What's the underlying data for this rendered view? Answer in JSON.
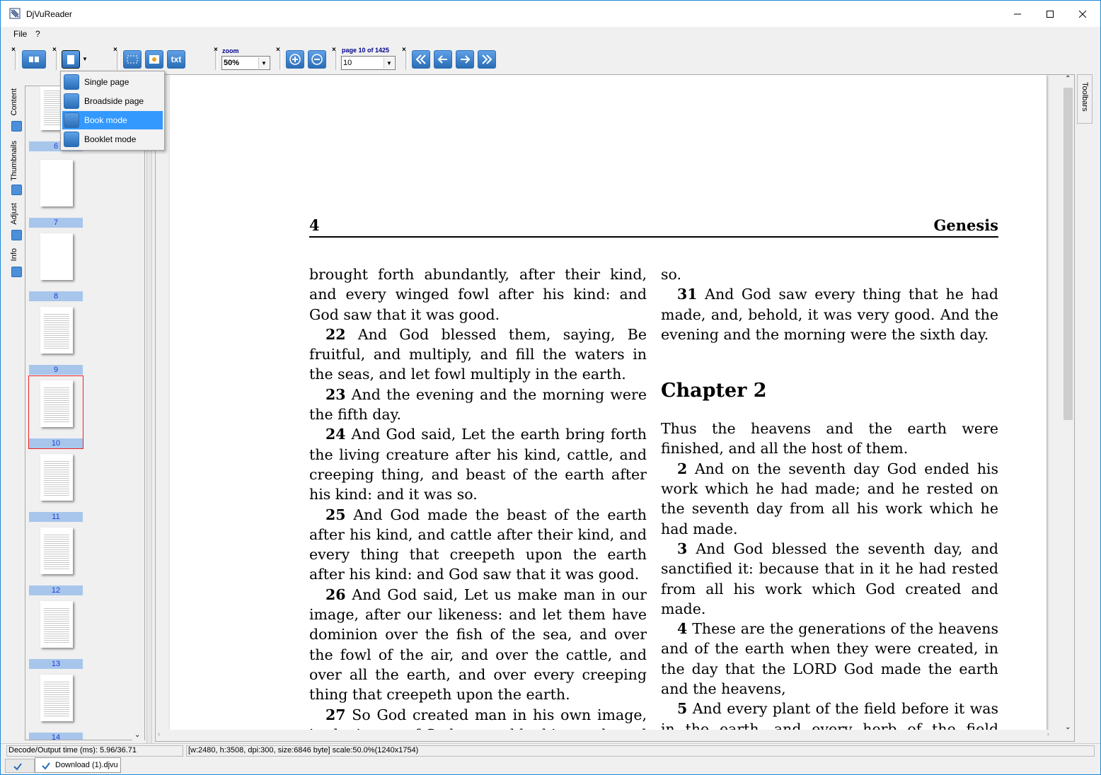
{
  "window": {
    "title": "DjVuReader"
  },
  "menubar": {
    "items": [
      "File",
      "?"
    ]
  },
  "toolbar": {
    "close_glyph": "×",
    "zoom_label": "zoom",
    "zoom_value": "50%",
    "page_label": "page 10 of 1425",
    "page_value": "10",
    "text_button_label": "txt"
  },
  "view_mode_menu": {
    "items": [
      {
        "label": "Single page",
        "icon": "single-page-icon"
      },
      {
        "label": "Broadside page",
        "icon": "broadside-page-icon"
      },
      {
        "label": "Book mode",
        "icon": "book-mode-icon",
        "selected": true
      },
      {
        "label": "Booklet mode",
        "icon": "booklet-mode-icon"
      }
    ]
  },
  "side_tabs": [
    "Content",
    "Thumbnails",
    "Adjust",
    "Info"
  ],
  "thumbnails": {
    "pages": [
      "6",
      "7",
      "8",
      "9",
      "10",
      "11",
      "12",
      "13",
      "14"
    ],
    "selected": "10"
  },
  "right_tab": "Toolbars",
  "document": {
    "page_number": "4",
    "running_title": "Genesis",
    "left_column": [
      {
        "num": "",
        "text": "brought forth abundantly, after their kind, and every winged fowl after his kind: and God saw that it was good."
      },
      {
        "num": "22",
        "text": "And God blessed them, saying, Be fruitful, and multiply, and fill the waters in the seas, and let fowl multiply in the earth."
      },
      {
        "num": "23",
        "text": "And the evening and the morning were the fifth day."
      },
      {
        "num": "24",
        "text": "And God said, Let the earth bring forth the living creature after his kind, cattle, and creeping thing, and beast of the earth after his kind: and it was so."
      },
      {
        "num": "25",
        "text": "And God made the beast of the earth after his kind, and cattle after their kind, and every thing that creepeth upon the earth after his kind: and God saw that it was good."
      },
      {
        "num": "26",
        "text": "And God said, Let us make man in our image, after our likeness: and let them have dominion over the fish of the sea, and over the fowl of the air, and over the cattle, and over all the earth, and over every creeping thing that creepeth upon the earth."
      },
      {
        "num": "27",
        "text": "So God created man in his own image, in the image of God created he him; male and female created he them."
      }
    ],
    "right_column_top": [
      {
        "num": "",
        "text": "so."
      },
      {
        "num": "31",
        "text": "And God saw every thing that he had made, and, behold, it was very good. And the evening and the morning were the sixth day."
      }
    ],
    "chapter_heading": "Chapter 2",
    "right_column_bottom": [
      {
        "num": "",
        "text": "Thus the heavens and the earth were finished, and all the host of them."
      },
      {
        "num": "2",
        "text": "And on the seventh day God ended his work which he had made; and he rested on the seventh day from all his work which he had made."
      },
      {
        "num": "3",
        "text": "And God blessed the seventh day, and sanctified it: because that in it he had rested from all his work which God created and made."
      },
      {
        "num": "4",
        "text": "These are the generations of the heavens and of the earth when they were created, in the day that the LORD God made the earth and the heavens,"
      },
      {
        "num": "5",
        "text": "And every plant of the field before it was in the earth, and every herb of the field before it grew: for the LORD God had not caused it to rain upon the earth, and there was not a man to till the ground."
      }
    ]
  },
  "status": {
    "decode_time": "Decode/Output time (ms): 5.96/36.71",
    "page_info": "[w:2480, h:3508, dpi:300, size:6846 byte] scale:50.0%(1240x1754)"
  },
  "file_tabs": [
    {
      "label": "Download (1).djvu"
    }
  ],
  "colors": {
    "accent": "#3399ff",
    "thumb_number_bg": "#a8c6ec",
    "thumb_number_text": "#1a3fd4",
    "selected_thumb_border": "#e22222"
  }
}
